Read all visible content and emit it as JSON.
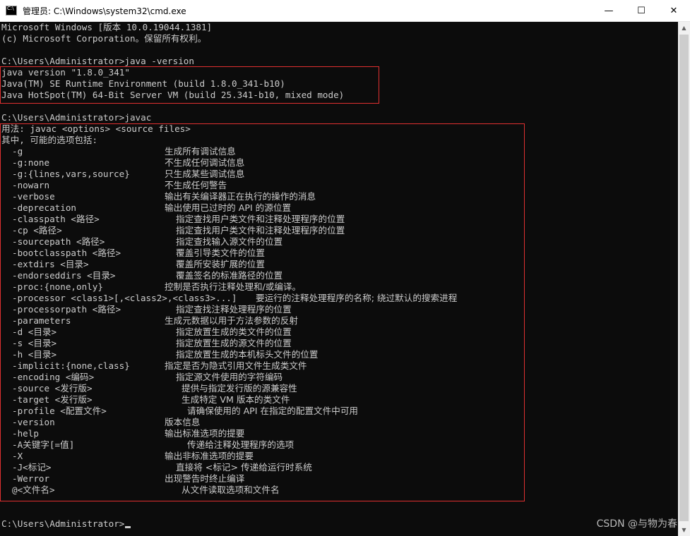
{
  "window": {
    "title": "管理员: C:\\Windows\\system32\\cmd.exe",
    "minimize": "—",
    "maximize": "☐",
    "close": "✕"
  },
  "console": {
    "header": [
      "Microsoft Windows [版本 10.0.19044.1381]",
      "(c) Microsoft Corporation。保留所有权利。"
    ],
    "cmd1": "C:\\Users\\Administrator>java -version",
    "version_output": [
      "java version \"1.8.0_341\"",
      "Java(TM) SE Runtime Environment (build 1.8.0_341-b10)",
      "Java HotSpot(TM) 64-Bit Server VM (build 25.341-b10, mixed mode)"
    ],
    "cmd2": "C:\\Users\\Administrator>javac",
    "usage": "用法: javac <options> <source files>",
    "options_intro": "其中, 可能的选项包括:",
    "options": [
      {
        "opt": "-g",
        "desc": "生成所有调试信息"
      },
      {
        "opt": "-g:none",
        "desc": "不生成任何调试信息"
      },
      {
        "opt": "-g:{lines,vars,source}",
        "desc": "只生成某些调试信息"
      },
      {
        "opt": "-nowarn",
        "desc": "不生成任何警告"
      },
      {
        "opt": "-verbose",
        "desc": "输出有关编译器正在执行的操作的消息"
      },
      {
        "opt": "-deprecation",
        "desc": "输出使用已过时的 API 的源位置"
      },
      {
        "opt": "-classpath <路径>",
        "desc": "指定查找用户类文件和注释处理程序的位置"
      },
      {
        "opt": "-cp <路径>",
        "desc": "指定查找用户类文件和注释处理程序的位置"
      },
      {
        "opt": "-sourcepath <路径>",
        "desc": "指定查找输入源文件的位置"
      },
      {
        "opt": "-bootclasspath <路径>",
        "desc": "覆盖引导类文件的位置"
      },
      {
        "opt": "-extdirs <目录>",
        "desc": "覆盖所安装扩展的位置"
      },
      {
        "opt": "-endorseddirs <目录>",
        "desc": "覆盖签名的标准路径的位置"
      },
      {
        "opt": "-proc:{none,only}",
        "desc": "控制是否执行注释处理和/或编译。"
      },
      {
        "opt": "-processor <class1>[,<class2>,<class3>...]",
        "desc": "要运行的注释处理程序的名称; 绕过默认的搜索进程"
      },
      {
        "opt": "-processorpath <路径>",
        "desc": "指定查找注释处理程序的位置"
      },
      {
        "opt": "-parameters",
        "desc": "生成元数据以用于方法参数的反射"
      },
      {
        "opt": "-d <目录>",
        "desc": "指定放置生成的类文件的位置"
      },
      {
        "opt": "-s <目录>",
        "desc": "指定放置生成的源文件的位置"
      },
      {
        "opt": "-h <目录>",
        "desc": "指定放置生成的本机标头文件的位置"
      },
      {
        "opt": "-implicit:{none,class}",
        "desc": "指定是否为隐式引用文件生成类文件"
      },
      {
        "opt": "-encoding <编码>",
        "desc": "指定源文件使用的字符编码"
      },
      {
        "opt": "-source <发行版>",
        "desc": "提供与指定发行版的源兼容性"
      },
      {
        "opt": "-target <发行版>",
        "desc": "生成特定 VM 版本的类文件"
      },
      {
        "opt": "-profile <配置文件>",
        "desc": "请确保使用的 API 在指定的配置文件中可用"
      },
      {
        "opt": "-version",
        "desc": "版本信息"
      },
      {
        "opt": "-help",
        "desc": "输出标准选项的提要"
      },
      {
        "opt": "-A关键字[=值]",
        "desc": "传递给注释处理程序的选项"
      },
      {
        "opt": "-X",
        "desc": "输出非标准选项的提要"
      },
      {
        "opt": "-J<标记>",
        "desc": "直接将 <标记> 传递给运行时系统"
      },
      {
        "opt": "-Werror",
        "desc": "出现警告时终止编译"
      },
      {
        "opt": "@<文件名>",
        "desc": "从文件读取选项和文件名"
      }
    ],
    "prompt": "C:\\Users\\Administrator>"
  },
  "watermark": "CSDN @与物为春",
  "colors": {
    "background": "#0c0c0c",
    "text": "#cccccc",
    "highlight_box": "#e03030"
  }
}
